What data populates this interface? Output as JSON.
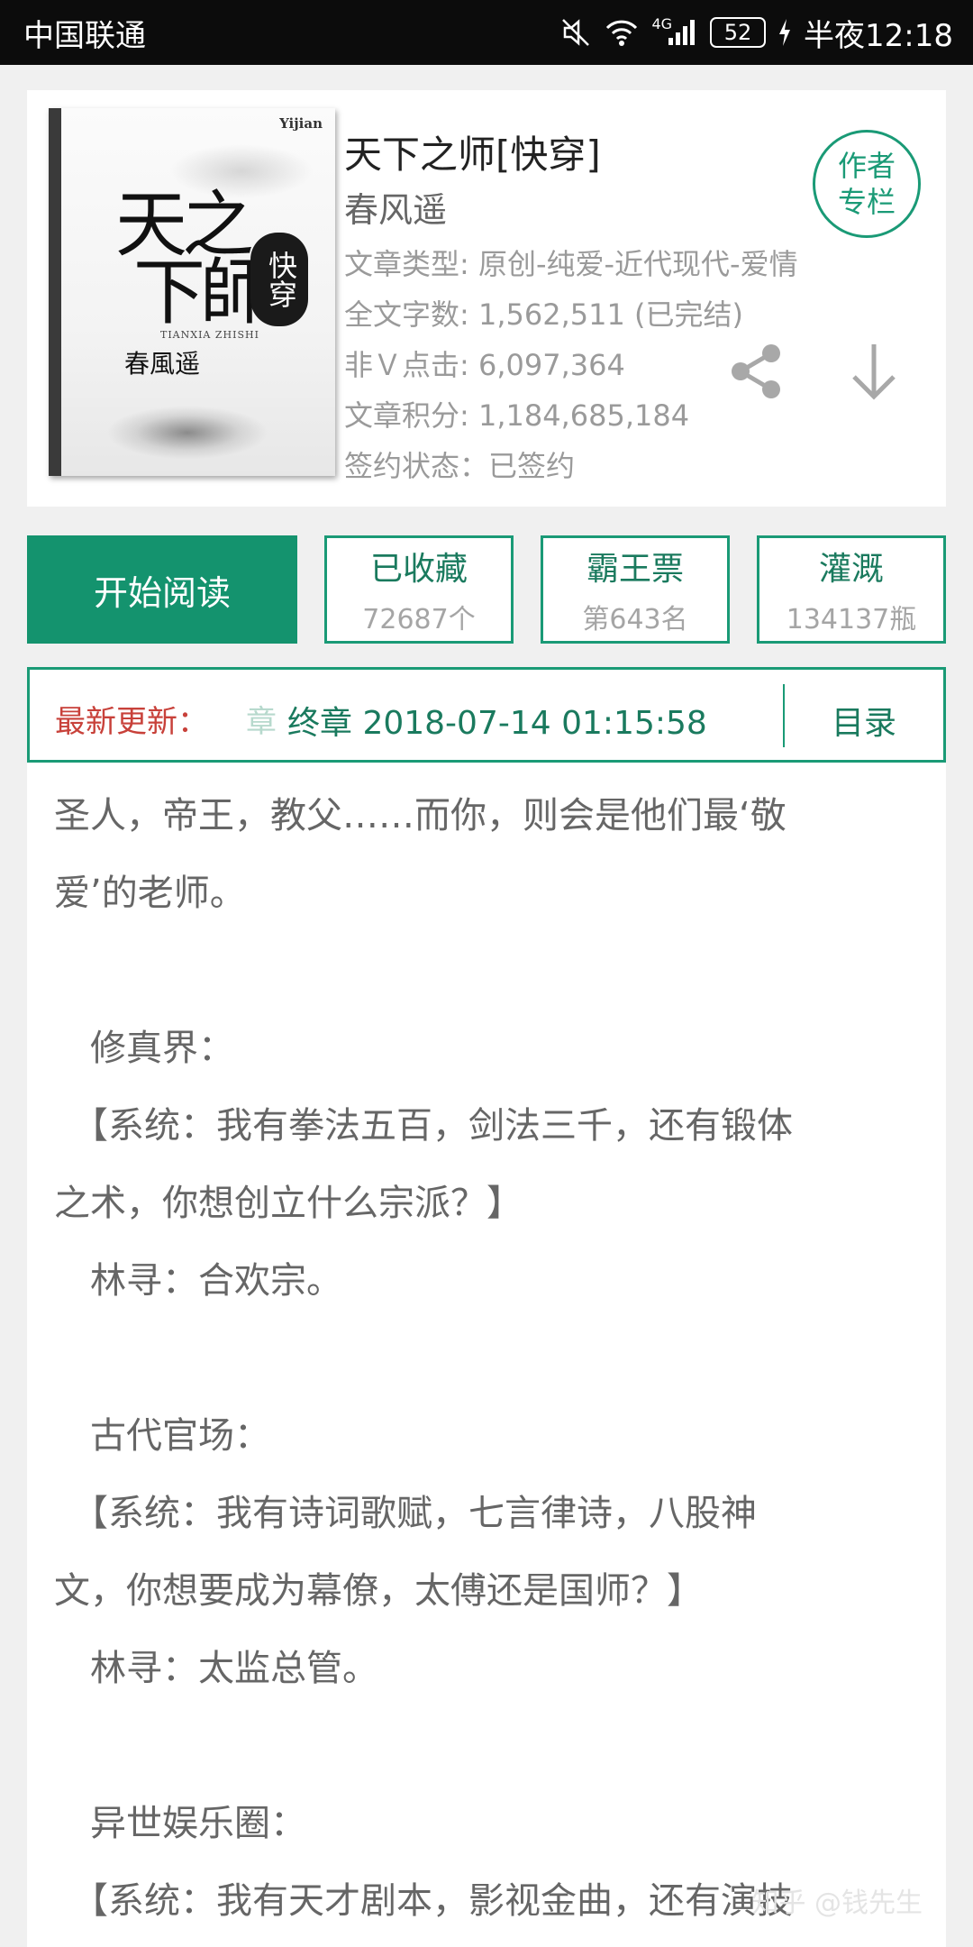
{
  "status_bar": {
    "carrier": "中国联通",
    "network": "4G",
    "battery": "52",
    "time": "半夜12:18"
  },
  "book": {
    "title": "天下之师[快穿]",
    "author": "春风遥",
    "meta": [
      "文章类型: 原创-纯爱-近代现代-爱情",
      "全文字数: 1,562,511 (已完结)",
      "非Ｖ点击: 6,097,364",
      "文章积分: 1,184,685,184",
      "签约状态：已签约"
    ],
    "author_column_line1": "作者",
    "author_column_line2": "专栏",
    "cover": {
      "publisher": "Yijian",
      "title_line1": "天之",
      "title_line2": "下師",
      "seal": "快穿",
      "romaji": "TIANXIA ZHISHI",
      "author": "春風遥"
    }
  },
  "actions": {
    "start_reading": "开始阅读",
    "stats": [
      {
        "label": "已收藏",
        "value": "72687个"
      },
      {
        "label": "霸王票",
        "value": "第643名"
      },
      {
        "label": "灌溉",
        "value": "134137瓶"
      }
    ]
  },
  "latest": {
    "label": "最新更新：",
    "faded": "章",
    "chapter": "终章  2018-07-14 01:15:58",
    "toc": "目录"
  },
  "content": {
    "lines": [
      "圣人，帝王，教父……而你，则会是他们最‘敬",
      "爱’的老师。",
      "",
      "　修真界：",
      "　【系统：我有拳法五百，剑法三千，还有锻体",
      "之术，你想创立什么宗派？】",
      "　林寻：合欢宗。",
      "",
      "　古代官场：",
      "　【系统：我有诗词歌赋，七言律诗，八股神",
      "文，你想要成为幕僚，太傅还是国师？】",
      "　林寻：太监总管。",
      "",
      "　异世娱乐圈：",
      "　【系统：我有天才剧本，影视金曲，还有演技"
    ]
  },
  "watermark": "知乎 @钱先生",
  "colors": {
    "accent": "#14936e",
    "latest_label": "#c8413a",
    "status_bar": "#0c0c0c"
  },
  "icons": [
    "share-icon",
    "download-icon",
    "wifi-icon",
    "mute-icon",
    "signal-icon",
    "battery-icon",
    "charging-icon"
  ]
}
